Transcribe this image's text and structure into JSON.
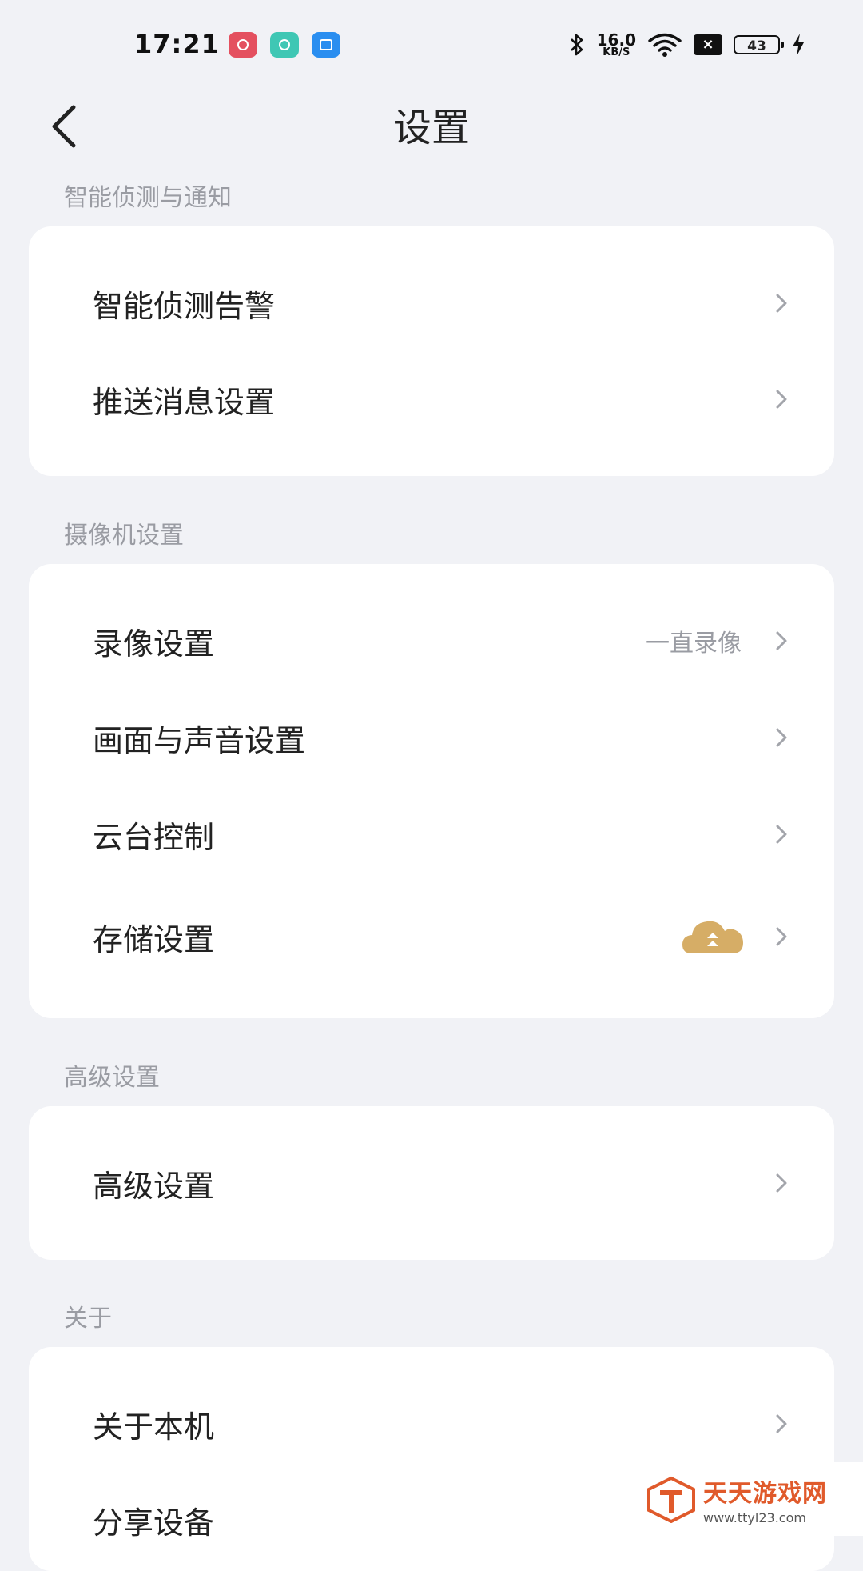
{
  "status_bar": {
    "time": "17:21",
    "net_speed_value": "16.0",
    "net_speed_unit": "KB/S",
    "battery": "43",
    "sim_status": "×"
  },
  "header": {
    "title": "设置",
    "back_icon": "back-chevron-icon"
  },
  "sections": {
    "detection": {
      "label": "智能侦测与通知",
      "items": [
        {
          "label": "智能侦测告警"
        },
        {
          "label": "推送消息设置"
        }
      ]
    },
    "camera": {
      "label": "摄像机设置",
      "items": [
        {
          "label": "录像设置",
          "value": "一直录像"
        },
        {
          "label": "画面与声音设置"
        },
        {
          "label": "云台控制"
        },
        {
          "label": "存储设置",
          "icon": "cloud-upload-icon"
        }
      ]
    },
    "advanced": {
      "label": "高级设置",
      "items": [
        {
          "label": "高级设置"
        }
      ]
    },
    "about": {
      "label": "关于",
      "items": [
        {
          "label": "关于本机"
        },
        {
          "label": "分享设备"
        }
      ]
    }
  },
  "watermark": {
    "name": "天天游戏网",
    "url": "www.ttyl23.com"
  },
  "colors": {
    "background": "#f1f2f6",
    "card": "#ffffff",
    "muted_text": "#9a9ca3",
    "cloud_gold": "#d6ad66"
  }
}
